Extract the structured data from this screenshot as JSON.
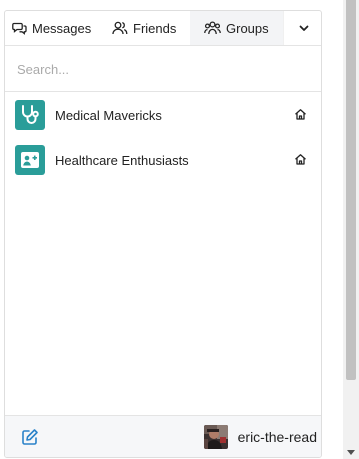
{
  "tabs": {
    "messages": "Messages",
    "friends": "Friends",
    "groups": "Groups",
    "active": "groups"
  },
  "search": {
    "placeholder": "Search..."
  },
  "groups": [
    {
      "name": "Medical Mavericks",
      "icon": "stethoscope-icon"
    },
    {
      "name": "Healthcare Enthusiasts",
      "icon": "medical-id-icon"
    }
  ],
  "footer": {
    "compose_icon": "edit-icon",
    "username": "eric-the-read"
  },
  "colors": {
    "group_avatar_bg": "#2a9d99",
    "compose_icon": "#2a82c9",
    "active_tab_bg": "#f3f4f6"
  }
}
